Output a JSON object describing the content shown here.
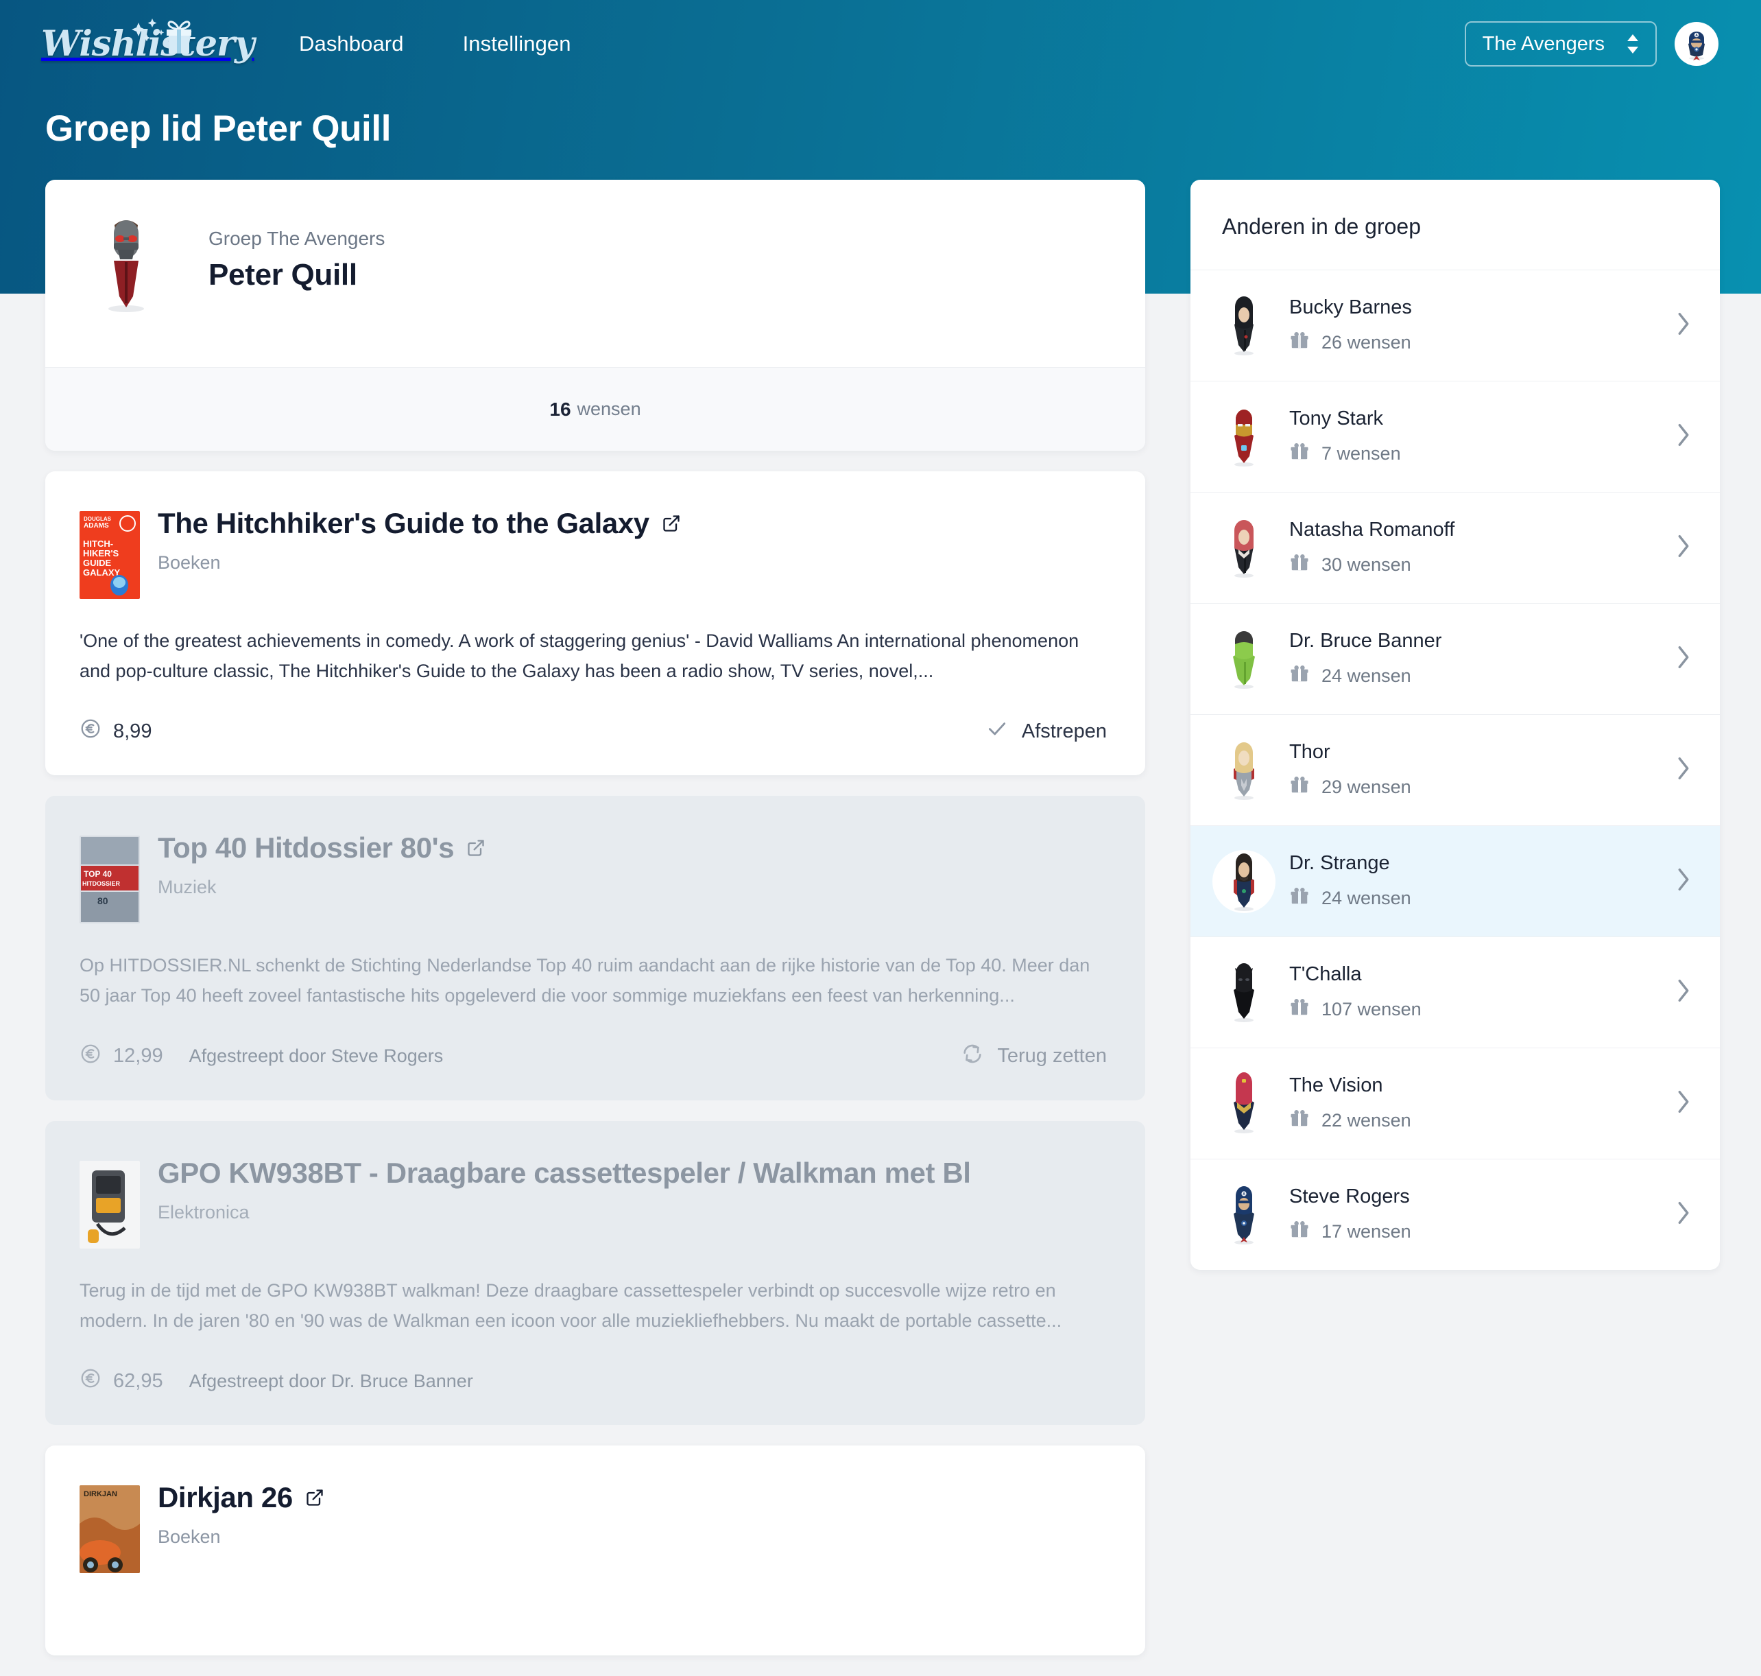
{
  "brand": {
    "name": "Wishlistery"
  },
  "nav": {
    "links": [
      {
        "label": "Dashboard"
      },
      {
        "label": "Instellingen"
      }
    ],
    "group_selector": {
      "value": "The Avengers"
    },
    "avatar_alt": "Steve Rogers"
  },
  "page": {
    "title": "Groep lid Peter Quill"
  },
  "profile": {
    "group_label": "Groep The Avengers",
    "name": "Peter Quill",
    "wish_count": "16",
    "wish_count_label": "wensen"
  },
  "wishes": [
    {
      "title": "The Hitchhiker's Guide to the Galaxy",
      "category": "Boeken",
      "description": "'One of the greatest achievements in comedy. A work of staggering genius' - David Walliams An international phenomenon and pop-culture classic, The Hitchhiker's Guide to the Galaxy has been a radio show, TV series, novel,...",
      "price": "8,99",
      "action": "Afstrepen",
      "action_icon": "check-icon",
      "struck": false,
      "struck_by": ""
    },
    {
      "title": "Top 40 Hitdossier 80's",
      "category": "Muziek",
      "description": "Op HITDOSSIER.NL schenkt de Stichting Nederlandse Top 40 ruim aandacht aan de rijke historie van de Top 40. Meer dan 50 jaar Top 40 heeft zoveel fantastische hits opgeleverd die voor sommige muziekfans een feest van herkenning...",
      "price": "12,99",
      "action": "Terug zetten",
      "action_icon": "restore-icon",
      "struck": true,
      "struck_by": "Afgestreept door Steve Rogers"
    },
    {
      "title": "GPO KW938BT - Draagbare cassettespeler / Walkman met Bl",
      "category": "Elektronica",
      "description": "Terug in de tijd met de GPO KW938BT walkman! Deze draagbare cassettespeler verbindt op succesvolle wijze retro en modern. In de jaren '80 en '90 was de Walkman een icoon voor alle muziekliefhebbers. Nu maakt de portable cassette...",
      "price": "62,95",
      "action": "",
      "action_icon": "",
      "struck": true,
      "struck_by": "Afgestreept door Dr. Bruce Banner"
    },
    {
      "title": "Dirkjan 26",
      "category": "Boeken",
      "description": "",
      "price": "",
      "action": "",
      "action_icon": "",
      "struck": false,
      "struck_by": ""
    }
  ],
  "sidebar": {
    "title": "Anderen in de groep",
    "members": [
      {
        "name": "Bucky Barnes",
        "wishes": "26 wensen",
        "active": false
      },
      {
        "name": "Tony Stark",
        "wishes": "7 wensen",
        "active": false
      },
      {
        "name": "Natasha Romanoff",
        "wishes": "30 wensen",
        "active": false
      },
      {
        "name": "Dr. Bruce Banner",
        "wishes": "24 wensen",
        "active": false
      },
      {
        "name": "Thor",
        "wishes": "29 wensen",
        "active": false
      },
      {
        "name": "Dr. Strange",
        "wishes": "24 wensen",
        "active": true
      },
      {
        "name": "T'Challa",
        "wishes": "107 wensen",
        "active": false
      },
      {
        "name": "The Vision",
        "wishes": "22 wensen",
        "active": false
      },
      {
        "name": "Steve Rogers",
        "wishes": "17 wensen",
        "active": false
      }
    ]
  },
  "colors": {
    "header_left": "#075681",
    "header_right": "#0890b0",
    "page_bg": "#f2f3f5",
    "card_bg": "#ffffff",
    "struck_bg": "#e7ebef",
    "active_row": "#eaf6fd",
    "text_dark": "#141c2f",
    "text_muted": "#8b95a3"
  }
}
